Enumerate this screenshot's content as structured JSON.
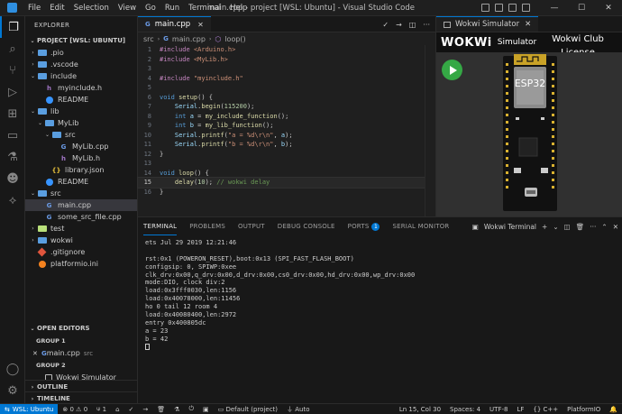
{
  "titlebar": {
    "menu": [
      "File",
      "Edit",
      "Selection",
      "View",
      "Go",
      "Run",
      "Terminal",
      "Help"
    ],
    "title": "main.cpp - project [WSL: Ubuntu] - Visual Studio Code"
  },
  "explorer": {
    "title": "EXPLORER",
    "project": "PROJECT [WSL: UBUNTU]",
    "items": [
      {
        "label": ".pio",
        "type": "folder",
        "depth": 1,
        "chev": "›"
      },
      {
        "label": ".vscode",
        "type": "folder",
        "depth": 1,
        "chev": "›"
      },
      {
        "label": "include",
        "type": "folder",
        "depth": 1,
        "chev": "⌄"
      },
      {
        "label": "myinclude.h",
        "type": "h",
        "depth": 2
      },
      {
        "label": "README",
        "type": "info",
        "depth": 2
      },
      {
        "label": "lib",
        "type": "folder",
        "depth": 1,
        "chev": "⌄"
      },
      {
        "label": "MyLib",
        "type": "folder",
        "depth": 2,
        "chev": "⌄"
      },
      {
        "label": "src",
        "type": "folder",
        "depth": 3,
        "chev": "⌄"
      },
      {
        "label": "MyLib.cpp",
        "type": "cpp",
        "depth": 4
      },
      {
        "label": "MyLib.h",
        "type": "h",
        "depth": 4
      },
      {
        "label": "library.json",
        "type": "json",
        "depth": 3
      },
      {
        "label": "README",
        "type": "info",
        "depth": 2
      },
      {
        "label": "src",
        "type": "folder",
        "depth": 1,
        "chev": "⌄"
      },
      {
        "label": "main.cpp",
        "type": "cpp",
        "depth": 2
      },
      {
        "label": "some_src_file.cpp",
        "type": "cpp",
        "depth": 2
      },
      {
        "label": "test",
        "type": "folder-test",
        "depth": 1,
        "chev": "›"
      },
      {
        "label": "wokwi",
        "type": "folder",
        "depth": 1,
        "chev": "›"
      },
      {
        "label": ".gitignore",
        "type": "git",
        "depth": 1
      },
      {
        "label": "platformio.ini",
        "type": "pio",
        "depth": 1
      }
    ],
    "open_editors": {
      "title": "OPEN EDITORS",
      "group1": "GROUP 1",
      "group1_file": "main.cpp",
      "group1_path": "src",
      "group2": "GROUP 2",
      "group2_file": "Wokwi Simulator"
    },
    "outline": "OUTLINE",
    "timeline": "TIMELINE"
  },
  "editor": {
    "tab": "main.cpp",
    "breadcrumb": [
      "src",
      "main.cpp",
      "loop()"
    ],
    "current_line": 15
  },
  "wokwi": {
    "tab": "Wokwi Simulator",
    "logo": "WOKWi",
    "simulator_label": "Simulator",
    "club_line1": "Wokwi Club",
    "club_line2": "License",
    "chip_label": "ESP32"
  },
  "panel": {
    "tabs": [
      "TERMINAL",
      "PROBLEMS",
      "OUTPUT",
      "DEBUG CONSOLE",
      "PORTS",
      "SERIAL MONITOR"
    ],
    "ports_badge": "1",
    "terminal_name": "Wokwi Terminal",
    "lines": [
      "ets Jul 29 2019 12:21:46",
      "",
      "rst:0x1 (POWERON_RESET),boot:0x13 (SPI_FAST_FLASH_BOOT)",
      "configsip: 0, SPIWP:0xee",
      "clk_drv:0x00,q_drv:0x00,d_drv:0x00,cs0_drv:0x00,hd_drv:0x00,wp_drv:0x00",
      "mode:DIO, clock div:2",
      "load:0x3fff0030,len:1156",
      "load:0x40078000,len:11456",
      "ho 0 tail 12 room 4",
      "load:0x40080400,len:2972",
      "entry 0x400805dc",
      "a = 23",
      "b = 42"
    ]
  },
  "statusbar": {
    "remote": "WSL: Ubuntu",
    "errors": "0",
    "warnings": "0",
    "ports": "1",
    "env": "Default (project)",
    "auto": "Auto",
    "position": "Ln 15, Col 30",
    "spaces": "Spaces: 4",
    "encoding": "UTF-8",
    "eol": "LF",
    "language": "C++",
    "platform": "PlatformIO"
  }
}
